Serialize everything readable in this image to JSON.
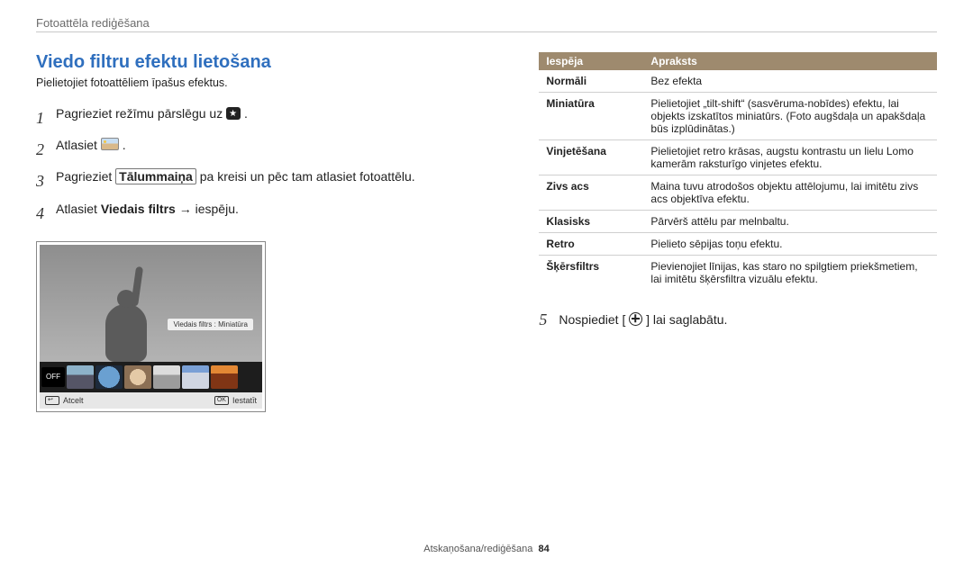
{
  "header": {
    "breadcrumb": "Fotoattēla rediģēšana"
  },
  "section": {
    "title": "Viedo filtru efektu lietošana",
    "subtitle": "Pielietojiet fotoattēliem īpašus efektus."
  },
  "steps": [
    {
      "num": "1",
      "pre": "Pagrieziet režīmu pārslēgu uz ",
      "icon": "mode-icon",
      "post": "."
    },
    {
      "num": "2",
      "pre": "Atlasiet ",
      "icon": "thumb-icon",
      "post": "."
    },
    {
      "num": "3",
      "pre": "Pagrieziet ",
      "boxed": "Tālummaiņa",
      "post": " pa kreisi un pēc tam atlasiet fotoattēlu."
    },
    {
      "num": "4",
      "pre": "Atlasiet ",
      "bold": "Viedais filtrs",
      "arrow": " → ",
      "post2": "iespēju."
    }
  ],
  "device": {
    "filter_label": "Viedais filtrs : Miniatūra",
    "off_label": "OFF",
    "bottom_left_key": "↩",
    "bottom_left": "Atcelt",
    "bottom_right_key": "OK",
    "bottom_right": "Iestatīt"
  },
  "table": {
    "head": {
      "c1": "Iespēja",
      "c2": "Apraksts"
    },
    "rows": [
      {
        "opt": "Normāli",
        "desc": "Bez efekta"
      },
      {
        "opt": "Miniatūra",
        "desc": "Pielietojiet „tilt-shift“ (sasvēruma-nobīdes) efektu, lai objekts izskatītos miniatūrs. (Foto augšdaļa un apakšdaļa būs izplūdinātas.)"
      },
      {
        "opt": "Vinjetēšana",
        "desc": "Pielietojiet retro krāsas, augstu kontrastu un lielu Lomo kamerām raksturīgo vinjetes efektu."
      },
      {
        "opt": "Zivs acs",
        "desc": "Maina tuvu atrodošos objektu attēlojumu, lai imitētu zivs acs objektīva efektu."
      },
      {
        "opt": "Klasisks",
        "desc": "Pārvērš attēlu par melnbaltu."
      },
      {
        "opt": "Retro",
        "desc": "Pielieto sēpijas toņu efektu."
      },
      {
        "opt": "Šķērsfiltrs",
        "desc": "Pievienojiet līnijas, kas staro no spilgtiem priekšmetiem, lai imitētu šķērsfiltra vizuālu efektu."
      }
    ]
  },
  "step5": {
    "num": "5",
    "pre": "Nospiediet [",
    "icon": "flower-icon",
    "post": "] lai saglabātu."
  },
  "footer": {
    "section": "Atskaņošana/rediģēšana",
    "page": "84"
  }
}
